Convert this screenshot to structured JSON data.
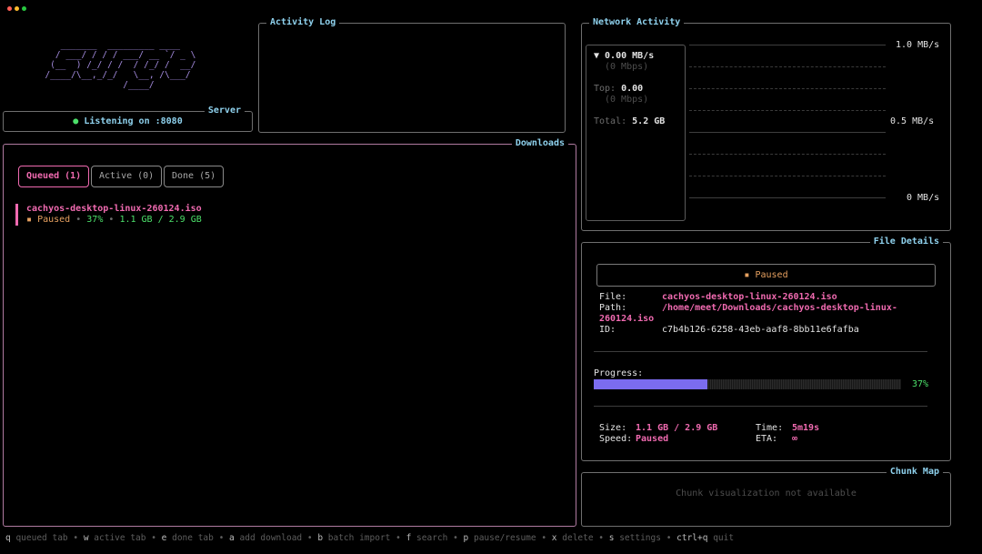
{
  "window": {
    "dots": [
      "#ff5f57",
      "#febc2e",
      "#28c840"
    ]
  },
  "logo": {
    "ascii": "     _______  _________ ____\n    / ___/ / / / ___/ __ `/ _ \\\n   (__  ) /_/ / /  / /_/ /  __/\n  /____/\\__,_/_/   \\__, /\\___/\n                 /____/"
  },
  "server": {
    "title": "Server",
    "status_dot": "●",
    "status": "Listening on :8080"
  },
  "activity_log": {
    "title": "Activity Log"
  },
  "network": {
    "title": "Network Activity",
    "current_speed": "▼ 0.00 MB/s",
    "current_mbps": "(0 Mbps)",
    "top_label": "Top:",
    "top_value": "0.00",
    "top_mbps": "(0 Mbps)",
    "total_label": "Total:",
    "total_value": "5.2 GB",
    "axis_top": "1.0 MB/s",
    "axis_mid": "0.5 MB/s",
    "axis_bottom": "0 MB/s"
  },
  "downloads": {
    "title": "Downloads",
    "tabs": [
      {
        "label": "Queued (1)"
      },
      {
        "label": "Active (0)"
      },
      {
        "label": "Done (5)"
      }
    ],
    "items": [
      {
        "name": "cachyos-desktop-linux-260124.iso",
        "status_icon": "▪",
        "status": "Paused",
        "separator": "•",
        "percent": "37%",
        "size": "1.1 GB / 2.9 GB"
      }
    ]
  },
  "file_details": {
    "title": "File Details",
    "status_icon": "▪",
    "status": "Paused",
    "file_label": "File:",
    "file_value": "cachyos-desktop-linux-260124.iso",
    "path_label": "Path:",
    "path_value_line1": "/home/meet/Downloads/cachyos-desktop-linux-",
    "path_value_line2": "260124.iso",
    "id_label": "ID:",
    "id_value": "c7b4b126-6258-43eb-aaf8-8bb11e6fafba",
    "progress_label": "Progress:",
    "progress_fraction": 0.37,
    "progress_text": "37%",
    "size_label": "Size:",
    "size_value": "1.1 GB / 2.9 GB",
    "time_label": "Time:",
    "time_value": "5m19s",
    "speed_label": "Speed:",
    "speed_value": "Paused",
    "eta_label": "ETA:",
    "eta_value": "∞"
  },
  "chunk_map": {
    "title": "Chunk Map",
    "message": "Chunk visualization not available"
  },
  "help": [
    {
      "key": "q",
      "label": "queued tab"
    },
    {
      "key": "w",
      "label": "active tab"
    },
    {
      "key": "e",
      "label": "done tab"
    },
    {
      "key": "a",
      "label": "add download"
    },
    {
      "key": "b",
      "label": "batch import"
    },
    {
      "key": "f",
      "label": "search"
    },
    {
      "key": "p",
      "label": "pause/resume"
    },
    {
      "key": "x",
      "label": "delete"
    },
    {
      "key": "s",
      "label": "settings"
    },
    {
      "key": "ctrl+q",
      "label": "quit"
    }
  ],
  "help_separator": "•",
  "colors": {
    "accent_pink": "#f06ab0",
    "accent_green": "#4ce06a",
    "accent_purple": "#a58ce0",
    "accent_cyan": "#8fd2ee",
    "progress_fill": "#7b6cf0"
  }
}
